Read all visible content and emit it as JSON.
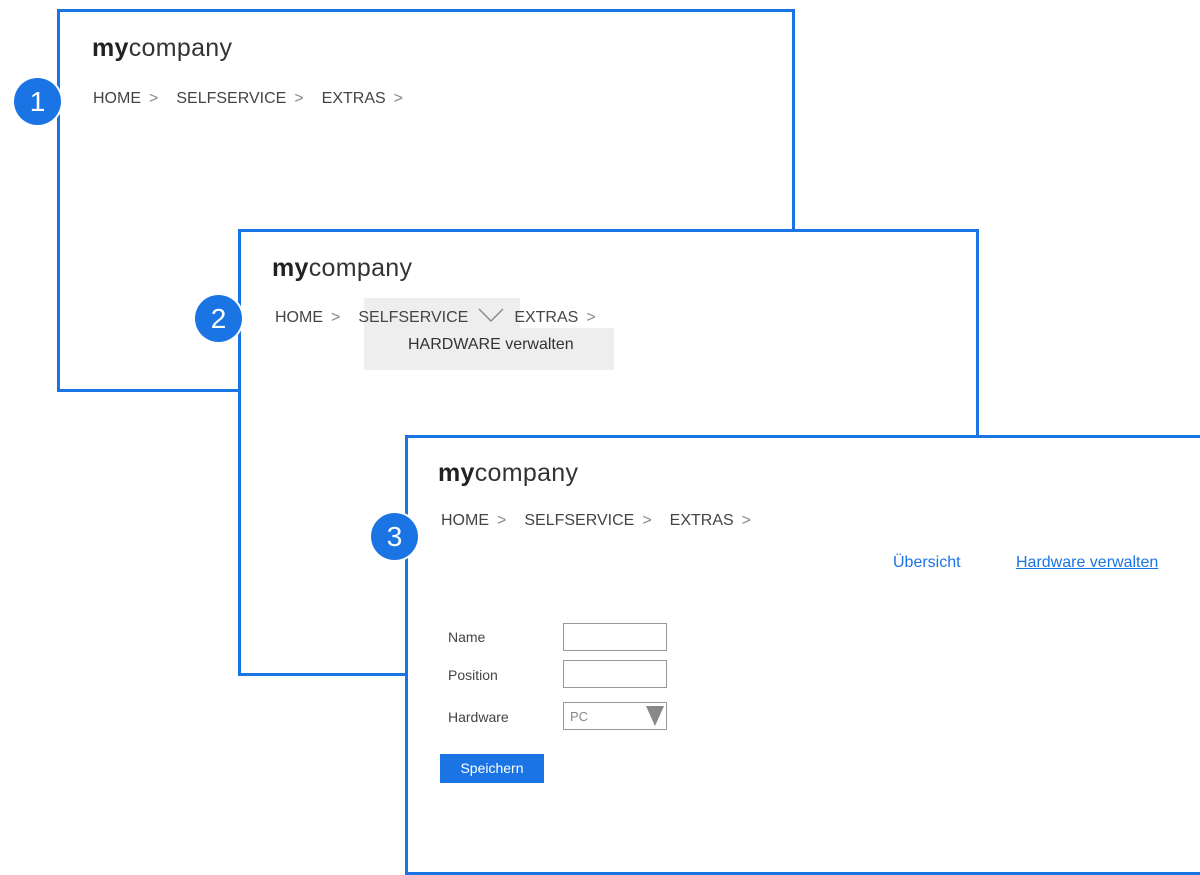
{
  "steps": [
    "1",
    "2",
    "3"
  ],
  "logo": {
    "my": "my",
    "company": "company"
  },
  "nav": {
    "home": "HOME",
    "selfservice": "SELFSERVICE",
    "extras": "EXTRAS",
    "chevron": ">"
  },
  "dropdown": {
    "item": "HARDWARE verwalten"
  },
  "links": {
    "overview": "Übersicht",
    "hardware": "Hardware verwalten"
  },
  "form": {
    "name_label": "Name",
    "name_value": "",
    "position_label": "Position",
    "position_value": "",
    "hardware_label": "Hardware",
    "hardware_selected": "PC",
    "save_label": "Speichern"
  },
  "colors": {
    "accent": "#1b74e4",
    "highlight": "#eeeeee"
  }
}
